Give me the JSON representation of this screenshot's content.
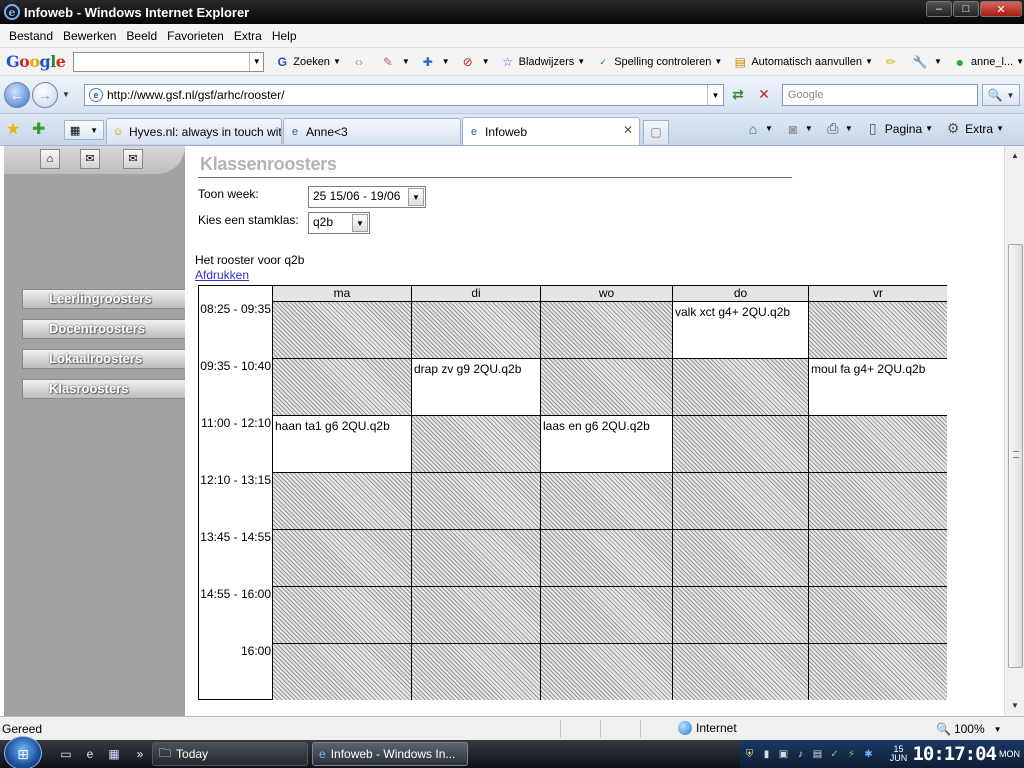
{
  "window": {
    "title": "Infoweb - Windows Internet Explorer",
    "minimize": "‒",
    "maximize": "□",
    "close": "✕"
  },
  "menu": [
    "Bestand",
    "Bewerken",
    "Beeld",
    "Favorieten",
    "Extra",
    "Help"
  ],
  "google_toolbar": {
    "logo": "Google",
    "search_value": "",
    "zoeken": "Zoeken",
    "bladwijzers": "Bladwijzers",
    "spelling": "Spelling controleren",
    "autofill": "Automatisch aanvullen",
    "account": "anne_l..."
  },
  "address": {
    "url": "http://www.gsf.nl/gsf/arhc/rooster/",
    "search_placeholder": "Google"
  },
  "tabs": [
    {
      "label": "Hyves.nl: always in touch wit...",
      "active": false
    },
    {
      "label": "Anne<3",
      "active": false
    },
    {
      "label": "Infoweb",
      "active": true
    }
  ],
  "command_bar": {
    "pagina": "Pagina",
    "extra": "Extra"
  },
  "sidebar": {
    "icons": [
      "home-icon",
      "mail-send-icon",
      "envelope-icon"
    ],
    "items": [
      "Leerlingroosters",
      "Docentroosters",
      "Lokaalroosters",
      "Klasroosters"
    ]
  },
  "page": {
    "title": "Klassenroosters",
    "week_label": "Toon week:",
    "week_value": "25 15/06 - 19/06",
    "class_label": "Kies een stamklas:",
    "class_value": "q2b",
    "rooster_title": "Het rooster voor q2b",
    "print_link": "Afdrukken"
  },
  "schedule": {
    "days": [
      "ma",
      "di",
      "wo",
      "do",
      "vr"
    ],
    "times": [
      "08:25 - 09:35",
      "09:35 - 10:40",
      "11:00 - 12:10",
      "12:10 - 13:15",
      "13:45 - 14:55",
      "14:55 - 16:00",
      "16:00"
    ],
    "lessons": [
      [
        "",
        "",
        "",
        "valk xct g4+ 2QU.q2b",
        ""
      ],
      [
        "",
        "drap zv g9 2QU.q2b",
        "",
        "",
        "moul fa g4+ 2QU.q2b"
      ],
      [
        "haan ta1 g6 2QU.q2b",
        "",
        "laas en g6 2QU.q2b",
        "",
        ""
      ],
      [
        "",
        "",
        "",
        "",
        ""
      ],
      [
        "",
        "",
        "",
        "",
        ""
      ],
      [
        "",
        "",
        "",
        "",
        ""
      ],
      [
        "",
        "",
        "",
        "",
        ""
      ]
    ]
  },
  "status": {
    "text": "Gereed",
    "zone": "Internet",
    "zoom": "100%"
  },
  "taskbar": {
    "tasks": [
      {
        "label": "Today",
        "active": false
      },
      {
        "label": "Infoweb - Windows In...",
        "active": true
      }
    ],
    "date_day": "15",
    "date_month": "JUN",
    "time": "10:17:04",
    "weekday": "MON"
  }
}
